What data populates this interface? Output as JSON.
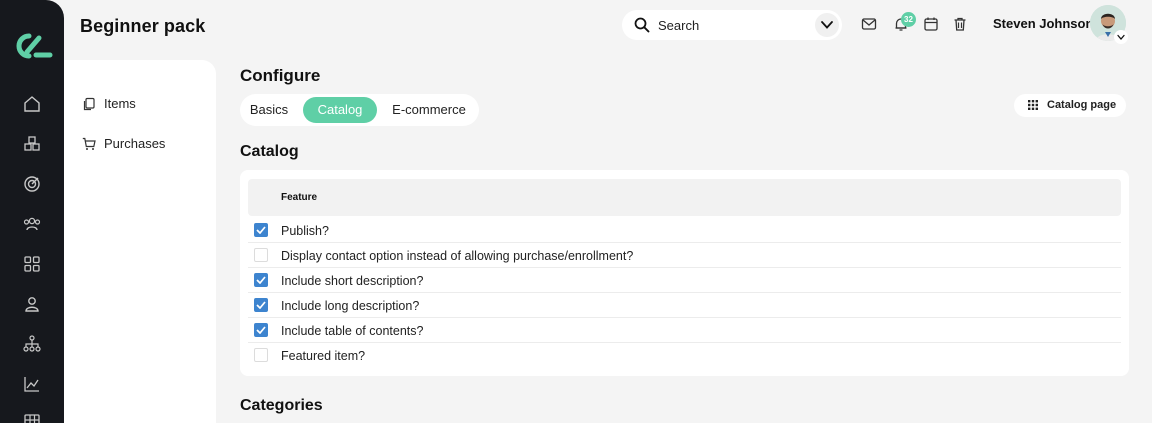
{
  "app": {
    "title": "Beginner pack"
  },
  "colors": {
    "accent": "#5fcfa6",
    "checkbox": "#3d84cf",
    "rail": "#16181d"
  },
  "rail": {
    "icons": [
      "home-icon",
      "cubes-icon",
      "target-icon",
      "users-icon",
      "grid-icon",
      "user-icon",
      "hierarchy-icon",
      "chart-icon",
      "table-icon"
    ]
  },
  "search": {
    "placeholder": "Search"
  },
  "header": {
    "notification_count": "32",
    "user_name": "Steven Johnson"
  },
  "sidebar": {
    "items": [
      {
        "label": "Items",
        "icon": "copy-icon"
      },
      {
        "label": "Purchases",
        "icon": "cart-icon"
      }
    ]
  },
  "configure": {
    "heading": "Configure",
    "tabs": [
      {
        "label": "Basics",
        "active": false
      },
      {
        "label": "Catalog",
        "active": true
      },
      {
        "label": "E-commerce",
        "active": false
      }
    ],
    "catalog_page_button": "Catalog page"
  },
  "catalog": {
    "heading": "Catalog",
    "column_header": "Feature",
    "rows": [
      {
        "label": "Publish?",
        "checked": true
      },
      {
        "label": "Display contact option instead of allowing purchase/enrollment?",
        "checked": false
      },
      {
        "label": "Include short description?",
        "checked": true
      },
      {
        "label": "Include long description?",
        "checked": true
      },
      {
        "label": "Include table of contents?",
        "checked": true
      },
      {
        "label": "Featured item?",
        "checked": false
      }
    ]
  },
  "categories": {
    "heading": "Categories"
  }
}
